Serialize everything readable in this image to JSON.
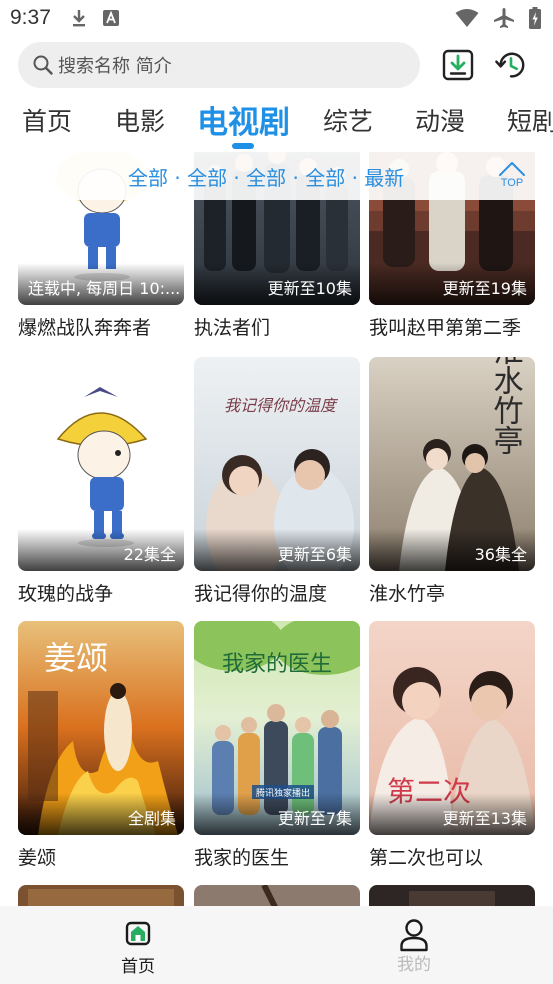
{
  "status": {
    "time": "9:37"
  },
  "search": {
    "placeholder": "搜索名称 简介"
  },
  "tabs": [
    {
      "label": "首页"
    },
    {
      "label": "电影"
    },
    {
      "label": "电视剧"
    },
    {
      "label": "综艺"
    },
    {
      "label": "动漫"
    },
    {
      "label": "短剧"
    }
  ],
  "active_tab": "电视剧",
  "filter": {
    "text": "全部 · 全部 · 全部 · 全部 · 最新",
    "top_label": "TOP"
  },
  "rows": [
    [
      {
        "title": "爆燃战队奔奔者",
        "badge": "连载中, 每周日 10:..."
      },
      {
        "title": "执法者们",
        "badge": "更新至10集"
      },
      {
        "title": "我叫赵甲第第二季",
        "badge": "更新至19集"
      }
    ],
    [
      {
        "title": "玫瑰的战争",
        "badge": "22集全"
      },
      {
        "title": "我记得你的温度",
        "badge": "更新至6集",
        "poster_text": "我记得你的温度"
      },
      {
        "title": "淮水竹亭",
        "badge": "36集全",
        "poster_text": "淮水竹亭"
      }
    ],
    [
      {
        "title": "姜颂",
        "badge": "全剧集",
        "poster_text": "姜颂"
      },
      {
        "title": "我家的医生",
        "badge": "更新至7集",
        "poster_text": "我家的医生",
        "poster_tag": "腾讯独家播出"
      },
      {
        "title": "第二次也可以",
        "badge": "更新至13集",
        "poster_text": "第二次"
      }
    ]
  ],
  "bottom_nav": [
    {
      "label": "首页",
      "icon": "home-icon",
      "active": true
    },
    {
      "label": "我的",
      "icon": "person-icon",
      "active": false
    }
  ],
  "colors": {
    "accent": "#1e90e6",
    "nav_active": "#1a1a1a",
    "nav_inactive": "#bbbbbb"
  }
}
